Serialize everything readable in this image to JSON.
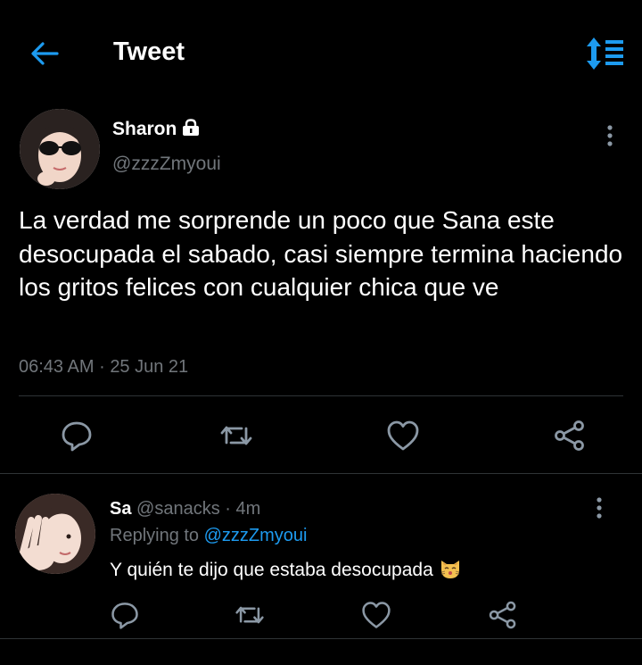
{
  "header": {
    "title": "Tweet"
  },
  "tweet": {
    "author_name": "Sharon",
    "author_handle": "@zzzZmyoui",
    "text": "La verdad me sorprende un poco que Sana este desocupada el sabado, casi siempre termina haciendo los gritos felices con cualquier chica que ve",
    "time": "06:43 AM",
    "date": "25 Jun 21",
    "separator": "·"
  },
  "reply": {
    "author_name": "Sa",
    "author_handle": "@sanacks",
    "age": "4m",
    "separator": "·",
    "replying_prefix": "Replying to",
    "replying_to": "@zzzZmyoui",
    "text": "Y quién te dijo que estaba desocupada",
    "emoji": "kissing-cat-emoji"
  },
  "colors": {
    "background": "#000000",
    "accent": "#1d9bf0",
    "muted": "#71767b",
    "icon": "#8b98a5",
    "divider": "#2f3336"
  },
  "icons": [
    "back-arrow-icon",
    "sort-list-icon",
    "lock-icon",
    "more-vertical-icon",
    "reply-icon",
    "retweet-icon",
    "like-icon",
    "share-icon"
  ]
}
